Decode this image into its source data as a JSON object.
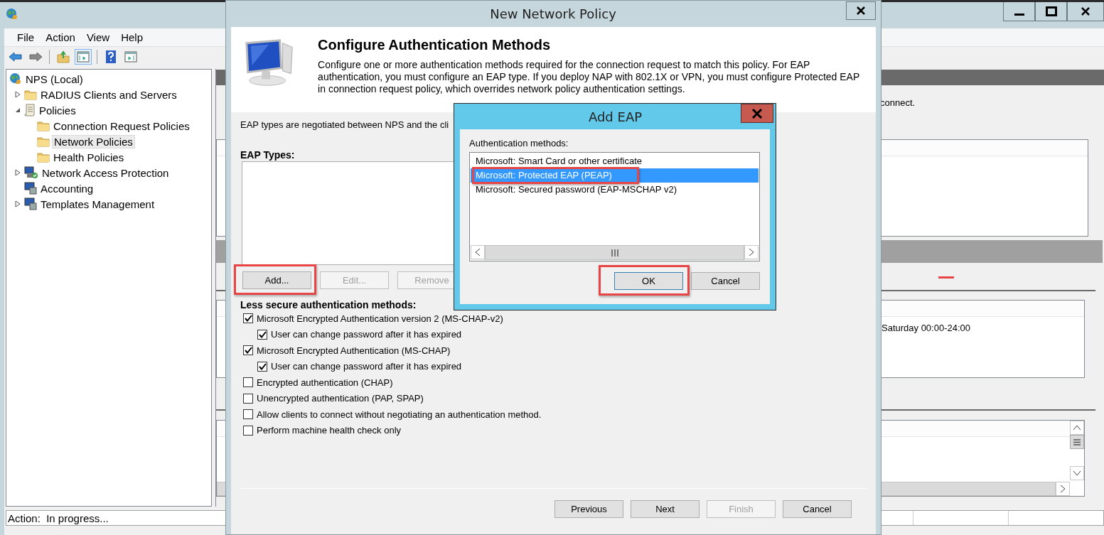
{
  "app_window": {
    "menu": [
      "File",
      "Action",
      "View",
      "Help"
    ],
    "toolbar": [
      {
        "kind": "back",
        "pressed": false
      },
      {
        "kind": "forward",
        "pressed": false
      },
      {
        "kind": "up",
        "pressed": false
      },
      {
        "kind": "tree-toggle",
        "pressed": true
      },
      {
        "kind": "help",
        "pressed": false
      },
      {
        "kind": "action-pane",
        "pressed": false
      }
    ],
    "tree": [
      {
        "label": "NPS (Local)",
        "kind": "root",
        "selected": false,
        "children": [
          {
            "label": "RADIUS Clients and Servers",
            "kind": "folder",
            "expanded": false,
            "selected": false
          },
          {
            "label": "Policies",
            "kind": "document",
            "expanded": true,
            "selected": false,
            "children": [
              {
                "label": "Connection Request Policies",
                "kind": "folder",
                "selected": false
              },
              {
                "label": "Network Policies",
                "kind": "folder",
                "selected": true
              },
              {
                "label": "Health Policies",
                "kind": "folder",
                "selected": false
              }
            ]
          },
          {
            "label": "Network Access Protection",
            "kind": "network",
            "expanded": false,
            "selected": false
          },
          {
            "label": "Accounting",
            "kind": "computer",
            "selected": false
          },
          {
            "label": "Templates Management",
            "kind": "computer",
            "expanded": false,
            "selected": false
          }
        ]
      }
    ],
    "details": {
      "text": "connect.",
      "schedule": "Saturday 00:00-24:00"
    },
    "status_bar": "Action:  In progress..."
  },
  "policy_dialog": {
    "title": "New Network Policy",
    "heading": "Configure Authentication Methods",
    "description": "Configure one or more authentication methods required for the connection request to match this policy. For EAP authentication, you must configure an EAP type. If you deploy NAP with 802.1X or VPN, you must configure Protected EAP in connection request policy, which overrides network policy authentication settings.",
    "eap_note": "EAP types are negotiated between NPS and the cli",
    "eap_types_label": "EAP Types:",
    "eap_buttons": [
      {
        "label": "Add...",
        "disabled": false,
        "highlighted": true
      },
      {
        "label": "Edit...",
        "disabled": true,
        "highlighted": false
      },
      {
        "label": "Remove",
        "disabled": true,
        "highlighted": false
      }
    ],
    "less_secure_label": "Less secure authentication methods:",
    "methods": [
      {
        "label": "Microsoft Encrypted Authentication version 2 (MS-CHAP-v2)",
        "checked": true,
        "children": [
          {
            "label": "User can change password after it has expired",
            "checked": true
          }
        ]
      },
      {
        "label": "Microsoft Encrypted Authentication (MS-CHAP)",
        "checked": true,
        "children": [
          {
            "label": "User can change password after it has expired",
            "checked": true
          }
        ]
      },
      {
        "label": "Encrypted authentication (CHAP)",
        "checked": false
      },
      {
        "label": "Unencrypted authentication (PAP, SPAP)",
        "checked": false
      },
      {
        "label": "Allow clients to connect without negotiating an authentication method.",
        "checked": false
      },
      {
        "label": "Perform machine health check only",
        "checked": false
      }
    ],
    "footer_buttons": [
      {
        "label": "Previous",
        "disabled": false
      },
      {
        "label": "Next",
        "disabled": false
      },
      {
        "label": "Finish",
        "disabled": true
      },
      {
        "label": "Cancel",
        "disabled": false
      }
    ]
  },
  "add_eap_dialog": {
    "title": "Add EAP",
    "list_label": "Authentication methods:",
    "items": [
      {
        "label": "Microsoft: Smart Card or other certificate",
        "selected": false,
        "highlighted": false
      },
      {
        "label": "Microsoft: Protected EAP (PEAP)",
        "selected": true,
        "highlighted": true
      },
      {
        "label": "Microsoft: Secured password (EAP-MSCHAP v2)",
        "selected": false,
        "highlighted": false
      }
    ],
    "buttons": [
      {
        "label": "OK",
        "default": true,
        "highlighted": true
      },
      {
        "label": "Cancel",
        "default": false,
        "highlighted": false
      }
    ]
  }
}
